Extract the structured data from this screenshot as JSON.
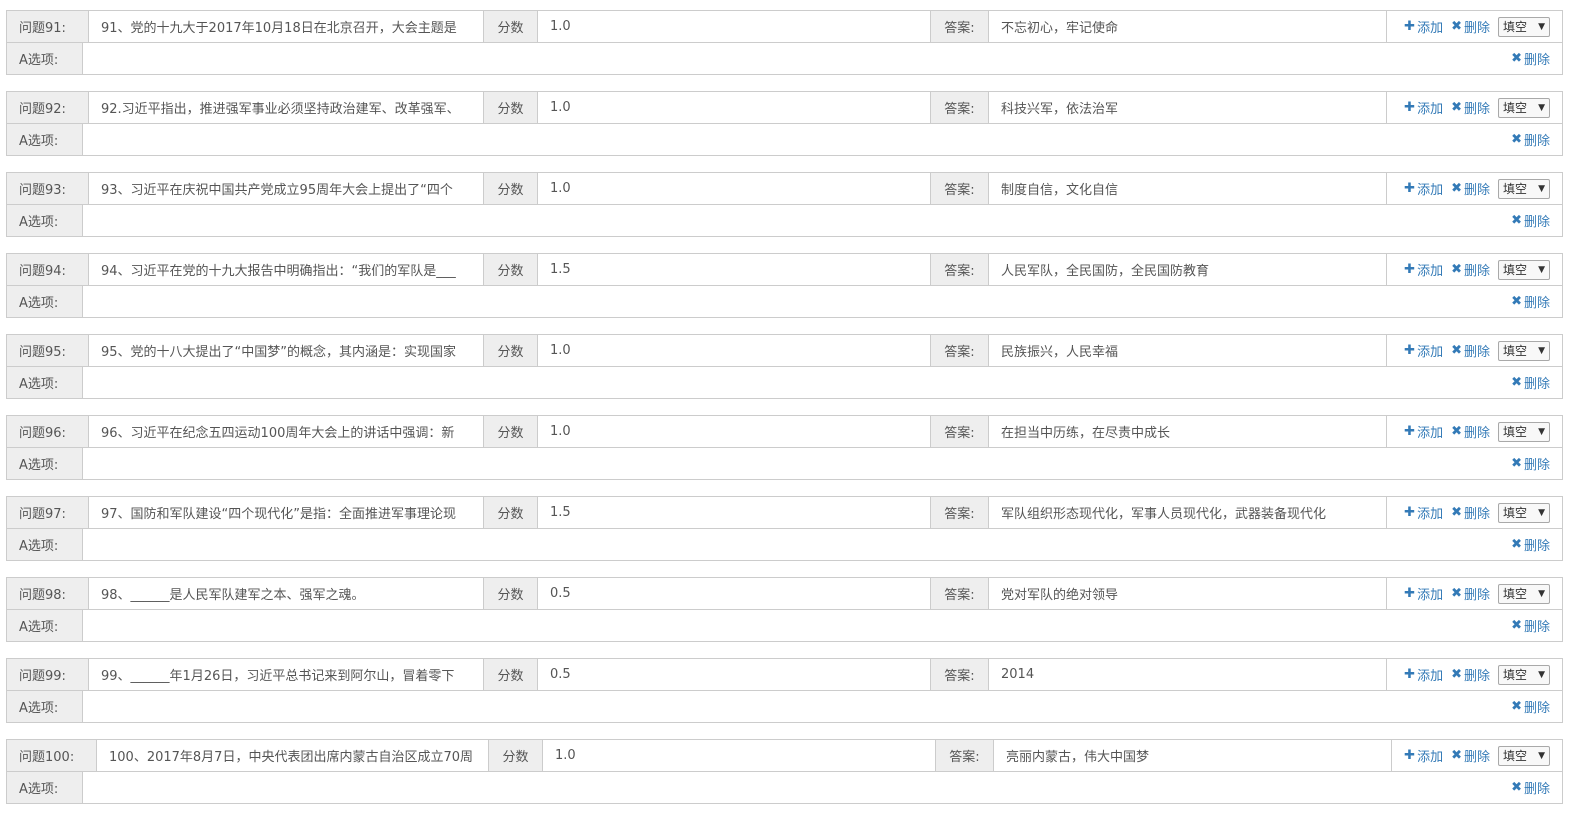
{
  "labels": {
    "score": "分数",
    "answer": "答案:",
    "add": "添加",
    "delete": "删除",
    "option_a": "A选项:"
  },
  "icons": {
    "add": "plus-icon",
    "delete": "x-icon",
    "caret": "caret-down-icon"
  },
  "colors": {
    "link": "#337ab7",
    "addon_bg": "#eeeeee",
    "border": "#cccccc"
  },
  "questions": [
    {
      "label": "问题91:",
      "text": "91、党的十九大于2017年10月18日在北京召开，大会主题是",
      "score": "1.0",
      "answer": "不忘初心，牢记使命",
      "type": "填空",
      "option_label": "A选项:"
    },
    {
      "label": "问题92:",
      "text": "92.习近平指出，推进强军事业必须坚持政治建军、改革强军、",
      "score": "1.0",
      "answer": "科技兴军，依法治军",
      "type": "填空",
      "option_label": "A选项:"
    },
    {
      "label": "问题93:",
      "text": "93、习近平在庆祝中国共产党成立95周年大会上提出了“四个",
      "score": "1.0",
      "answer": "制度自信，文化自信",
      "type": "填空",
      "option_label": "A选项:"
    },
    {
      "label": "问题94:",
      "text": "94、习近平在党的十九大报告中明确指出：“我们的军队是___",
      "score": "1.5",
      "answer": "人民军队，全民国防，全民国防教育",
      "type": "填空",
      "option_label": "A选项:"
    },
    {
      "label": "问题95:",
      "text": "95、党的十八大提出了“中国梦”的概念，其内涵是：实现国家",
      "score": "1.0",
      "answer": "民族振兴，人民幸福",
      "type": "填空",
      "option_label": "A选项:"
    },
    {
      "label": "问题96:",
      "text": "96、习近平在纪念五四运动100周年大会上的讲话中强调：新",
      "score": "1.0",
      "answer": "在担当中历练，在尽责中成长",
      "type": "填空",
      "option_label": "A选项:"
    },
    {
      "label": "问题97:",
      "text": "97、国防和军队建设“四个现代化”是指：全面推进军事理论现",
      "score": "1.5",
      "answer": "军队组织形态现代化，军事人员现代化，武器装备现代化",
      "type": "填空",
      "option_label": "A选项:"
    },
    {
      "label": "问题98:",
      "text": "98、______是人民军队建军之本、强军之魂。",
      "score": "0.5",
      "answer": "党对军队的绝对领导",
      "type": "填空",
      "option_label": "A选项:"
    },
    {
      "label": "问题99:",
      "text": "99、______年1月26日，习近平总书记来到阿尔山，冒着零下",
      "score": "0.5",
      "answer": "2014",
      "type": "填空",
      "option_label": "A选项:"
    },
    {
      "label": "问题100:",
      "text": "100、2017年8月7日，中央代表团出席内蒙古自治区成立70周",
      "score": "1.0",
      "answer": "亮丽内蒙古，伟大中国梦",
      "type": "填空",
      "option_label": "A选项:"
    }
  ]
}
